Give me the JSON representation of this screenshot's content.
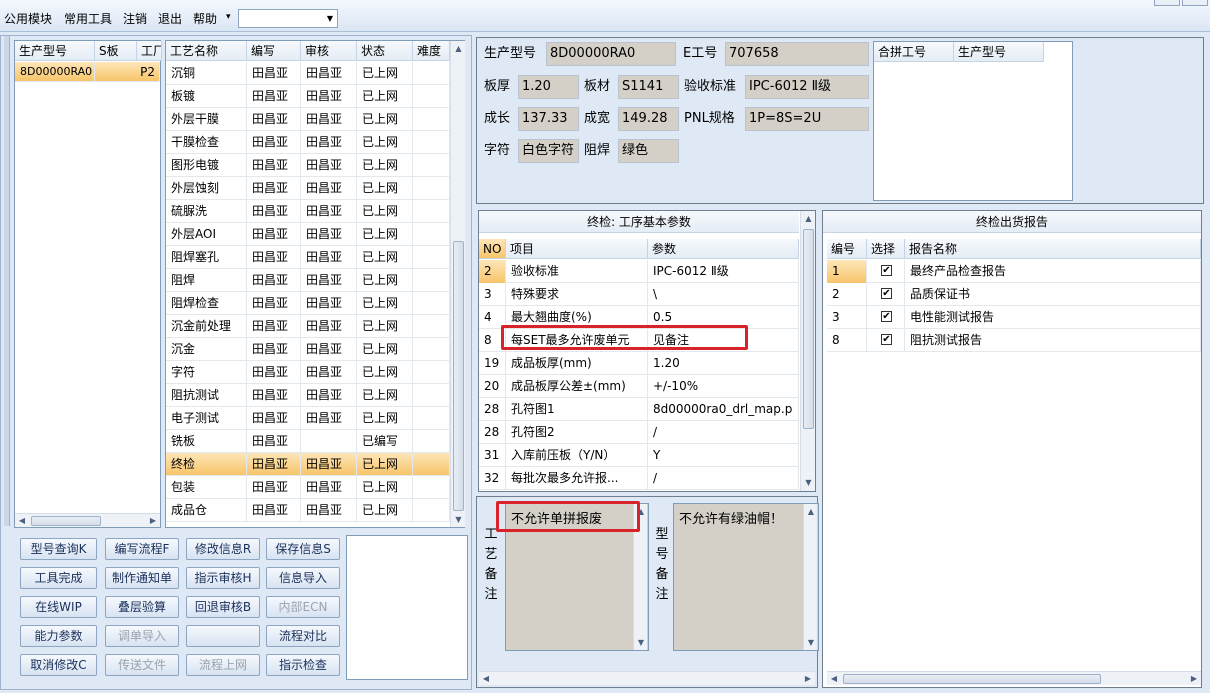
{
  "menu": {
    "items": [
      "公用模块",
      "常用工具",
      "注销",
      "退出",
      "帮助"
    ],
    "dropdown_arrow": "▾",
    "combo_value": ""
  },
  "product_list": {
    "headers": [
      "生产型号",
      "S板",
      "工厂"
    ],
    "rows": [
      [
        "8D00000RA0",
        "P2"
      ]
    ]
  },
  "process_table": {
    "headers": [
      "工艺名称",
      "编写",
      "审核",
      "状态",
      "难度"
    ],
    "rows": [
      [
        "沉铜",
        "田昌亚",
        "田昌亚",
        "已上网",
        ""
      ],
      [
        "板镀",
        "田昌亚",
        "田昌亚",
        "已上网",
        ""
      ],
      [
        "外层干膜",
        "田昌亚",
        "田昌亚",
        "已上网",
        ""
      ],
      [
        "干膜检查",
        "田昌亚",
        "田昌亚",
        "已上网",
        ""
      ],
      [
        "图形电镀",
        "田昌亚",
        "田昌亚",
        "已上网",
        ""
      ],
      [
        "外层蚀刻",
        "田昌亚",
        "田昌亚",
        "已上网",
        ""
      ],
      [
        "硫脲洗",
        "田昌亚",
        "田昌亚",
        "已上网",
        ""
      ],
      [
        "外层AOI",
        "田昌亚",
        "田昌亚",
        "已上网",
        ""
      ],
      [
        "阻焊塞孔",
        "田昌亚",
        "田昌亚",
        "已上网",
        ""
      ],
      [
        "阻焊",
        "田昌亚",
        "田昌亚",
        "已上网",
        ""
      ],
      [
        "阻焊检查",
        "田昌亚",
        "田昌亚",
        "已上网",
        ""
      ],
      [
        "沉金前处理",
        "田昌亚",
        "田昌亚",
        "已上网",
        ""
      ],
      [
        "沉金",
        "田昌亚",
        "田昌亚",
        "已上网",
        ""
      ],
      [
        "字符",
        "田昌亚",
        "田昌亚",
        "已上网",
        ""
      ],
      [
        "阻抗测试",
        "田昌亚",
        "田昌亚",
        "已上网",
        ""
      ],
      [
        "电子测试",
        "田昌亚",
        "田昌亚",
        "已上网",
        ""
      ],
      [
        "铣板",
        "田昌亚",
        "",
        "已编写",
        ""
      ],
      [
        "终检",
        "田昌亚",
        "田昌亚",
        "已上网",
        ""
      ],
      [
        "包装",
        "田昌亚",
        "田昌亚",
        "已上网",
        ""
      ],
      [
        "成品仓",
        "田昌亚",
        "田昌亚",
        "已上网",
        ""
      ]
    ],
    "selected_row": 17
  },
  "buttons": [
    [
      "型号查询K",
      "编写流程F",
      "修改信息R",
      "保存信息S"
    ],
    [
      "工具完成",
      "制作通知单",
      "指示审核H",
      "信息导入"
    ],
    [
      "在线WIP",
      "叠层验算",
      "回退审核B",
      "内部ECN"
    ],
    [
      "能力参数",
      "调单导入",
      "",
      "流程对比"
    ],
    [
      "取消修改C",
      "传送文件",
      "流程上网",
      "指示检查"
    ]
  ],
  "disabled_buttons": [
    "内部ECN",
    "调单导入",
    "传送文件",
    "流程上网"
  ],
  "info": {
    "product_model_label": "生产型号",
    "product_model": "8D00000RA0",
    "e_no_label": "E工号",
    "e_no": "707658",
    "thickness_label": "板厚",
    "thickness": "1.20",
    "material_label": "板材",
    "material": "S1141",
    "standard_label": "验收标准",
    "standard": "IPC-6012 Ⅱ级",
    "length_label": "成长",
    "length": "137.33",
    "width_label": "成宽",
    "width": "149.28",
    "pnl_label": "PNL规格",
    "pnl": "1P=8S=2U",
    "legend_label": "字符",
    "legend": "白色字符",
    "mask_label": "阻焊",
    "mask": "绿色"
  },
  "merge_table": {
    "headers": [
      "合拼工号",
      "生产型号"
    ]
  },
  "params_panel": {
    "title": "终检: 工序基本参数",
    "headers": [
      "NO",
      "项目",
      "参数"
    ],
    "rows": [
      [
        "2",
        "验收标准",
        "IPC-6012 Ⅱ级"
      ],
      [
        "3",
        "特殊要求",
        "\\"
      ],
      [
        "4",
        "最大翘曲度(%)",
        "0.5"
      ],
      [
        "8",
        "每SET最多允许废单元",
        "见备注"
      ],
      [
        "19",
        "成品板厚(mm)",
        "1.20"
      ],
      [
        "20",
        "成品板厚公差±(mm)",
        "+/-10%"
      ],
      [
        "28",
        "孔符图1",
        "8d00000ra0_drl_map.p"
      ],
      [
        "28",
        "孔符图2",
        "/"
      ],
      [
        "31",
        "入库前压板（Y/N）",
        "Y"
      ],
      [
        "32",
        "每批次最多允许报...",
        "/"
      ]
    ]
  },
  "report_panel": {
    "title": "终检出货报告",
    "headers": [
      "编号",
      "选择",
      "报告名称"
    ],
    "rows": [
      [
        "1",
        "最终产品检查报告"
      ],
      [
        "2",
        "品质保证书"
      ],
      [
        "3",
        "电性能测试报告"
      ],
      [
        "8",
        "阻抗测试报告"
      ]
    ],
    "check_mark": "✔"
  },
  "remarks": {
    "process_label": [
      "工",
      "艺",
      "备",
      "注"
    ],
    "process_text": "不允许单拼报废",
    "model_label": [
      "型",
      "号",
      "备",
      "注"
    ],
    "model_text": "不允许有绿油帽！"
  },
  "colors": {
    "selected": "#f7c56a",
    "highlight_box": "#d8232a",
    "readonly_bg": "#d4d0c8"
  }
}
